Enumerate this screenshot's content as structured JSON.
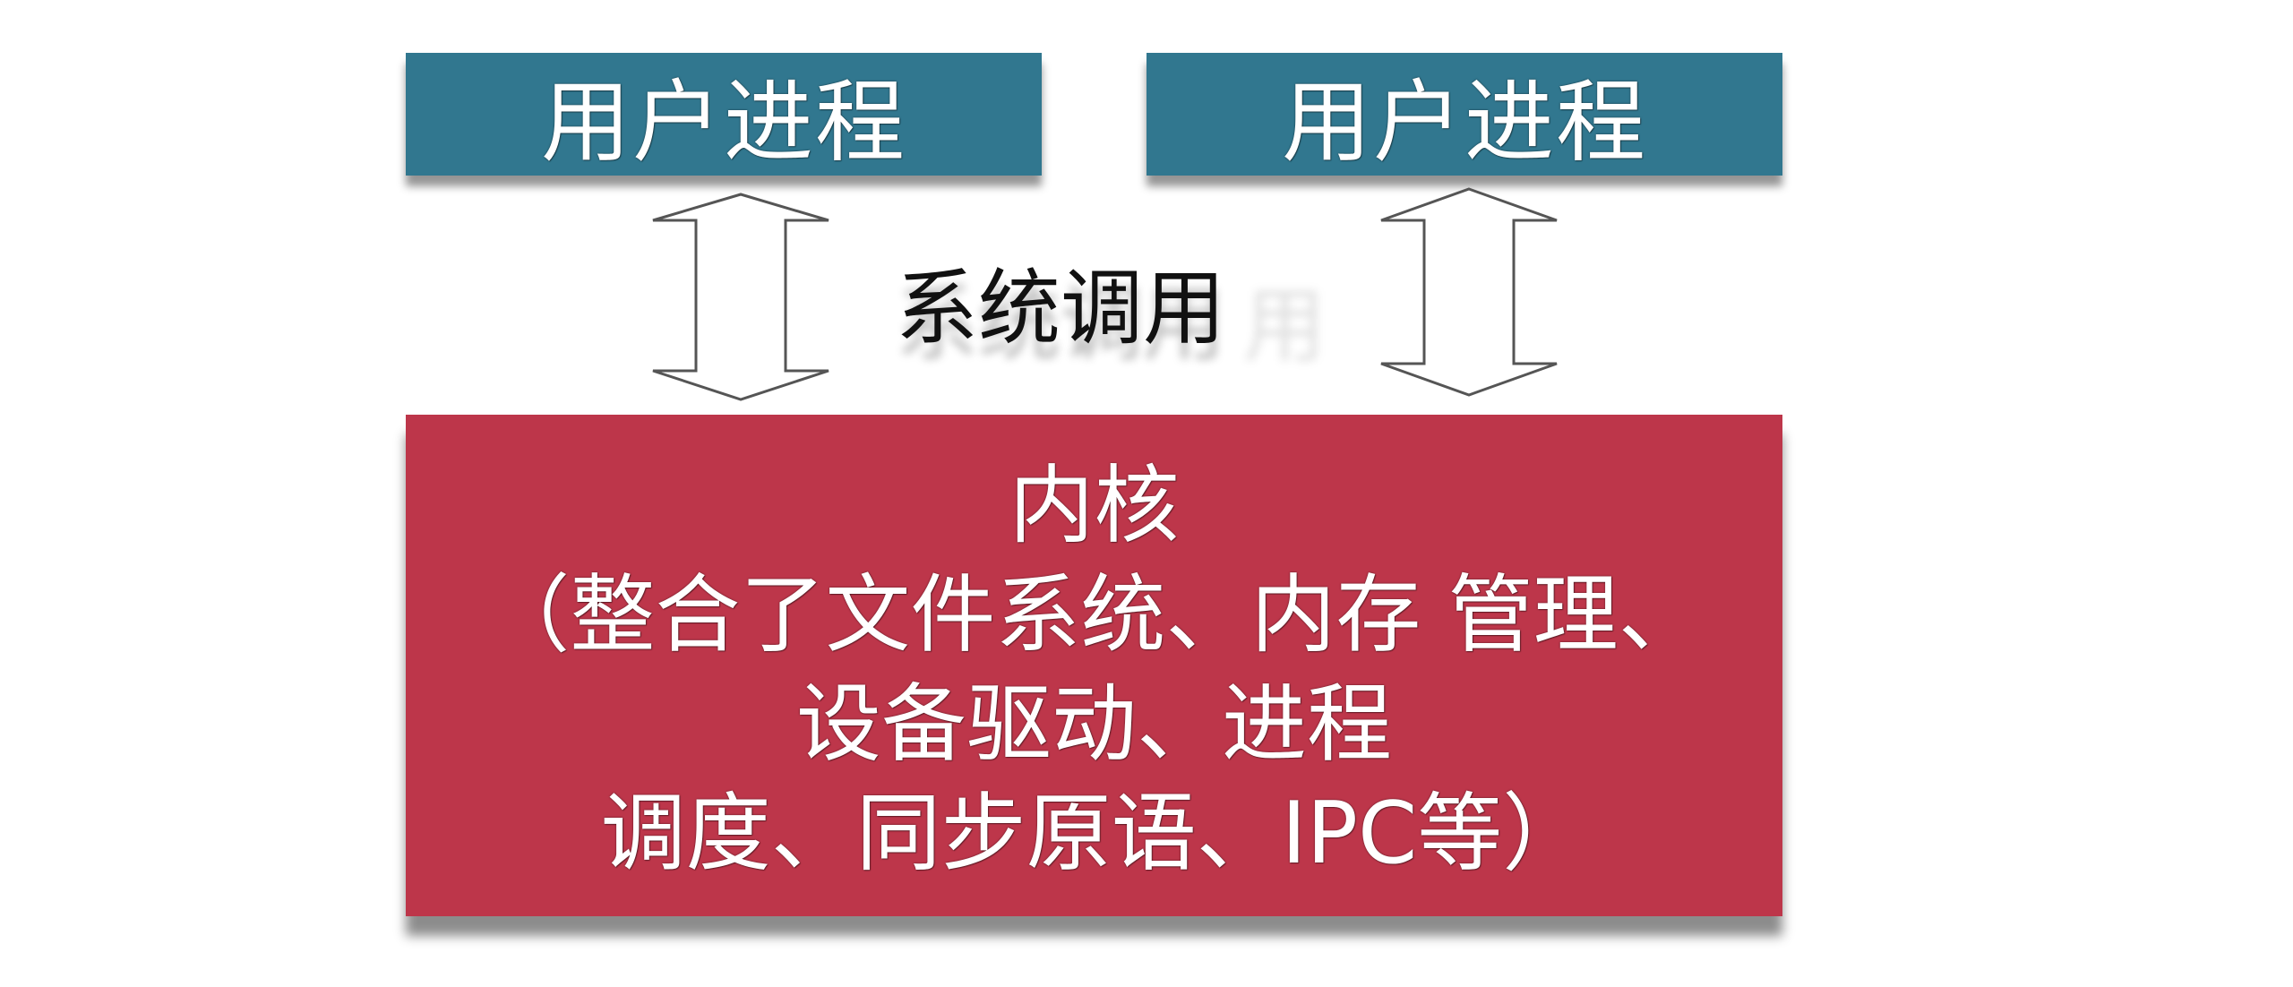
{
  "diagram": {
    "user_process_left": "用户进程",
    "user_process_right": "用户进程",
    "system_call_label": "系统调用",
    "system_call_ghost": "用",
    "kernel": {
      "line1": "内核",
      "line2": "（整合了文件系统、内存 管理、",
      "line3": "设备驱动、进程",
      "line4": "调度、同步原语、IPC等）"
    }
  },
  "colors": {
    "user_process_fill": "#31778f",
    "kernel_fill": "#bd364a",
    "arrow_fill": "#ffffff",
    "arrow_stroke": "#555555"
  }
}
